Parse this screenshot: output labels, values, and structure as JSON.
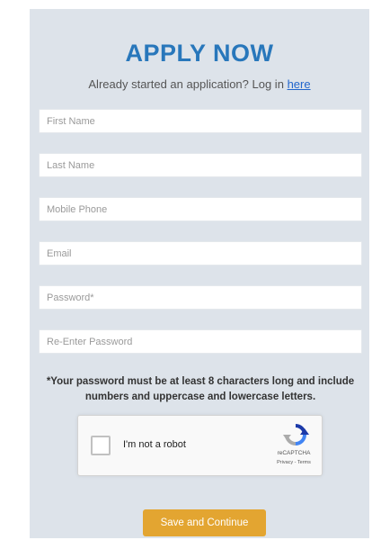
{
  "form": {
    "title": "APPLY NOW",
    "subtitle_prefix": "Already started an application? Log in",
    "login_link": "here",
    "fields": {
      "first_name": "First Name",
      "last_name": "Last Name",
      "mobile_phone": "Mobile Phone",
      "email": "Email",
      "password": "Password*",
      "reenter_password": "Re-Enter Password"
    },
    "password_note": "*Your password must be at least 8 characters long and include numbers and uppercase and lowercase letters.",
    "submit_label": "Save and Continue"
  },
  "captcha": {
    "checkbox_label": "I'm not a robot",
    "brand": "reCAPTCHA",
    "links": "Privacy - Terms"
  },
  "colors": {
    "panel_background": "#dde3ea",
    "title": "#2877bb",
    "button": "#e3a531"
  },
  "icons": {
    "captcha_logo": "recaptcha-logo-icon"
  }
}
